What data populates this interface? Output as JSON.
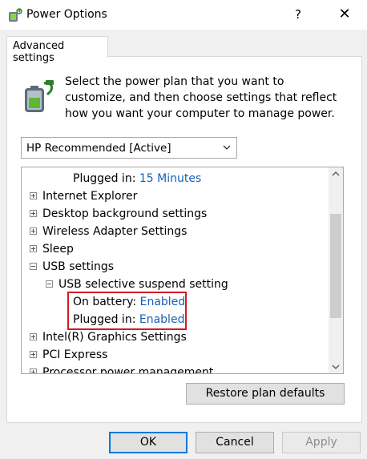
{
  "window": {
    "title": "Power Options",
    "help_label": "?",
    "close_label": "✕"
  },
  "tab": {
    "label": "Advanced settings"
  },
  "intro": {
    "text": "Select the power plan that you want to customize, and then choose settings that reflect how you want your computer to manage power."
  },
  "plan_select": {
    "value": "HP Recommended [Active]"
  },
  "tree": {
    "partial_top": {
      "label": "Plugged in:",
      "value": "15 Minutes"
    },
    "items": [
      {
        "label": "Internet Explorer"
      },
      {
        "label": "Desktop background settings"
      },
      {
        "label": "Wireless Adapter Settings"
      },
      {
        "label": "Sleep"
      },
      {
        "label": "USB settings"
      },
      {
        "label": "USB selective suspend setting"
      },
      {
        "label": "On battery:",
        "value": "Enabled"
      },
      {
        "label": "Plugged in:",
        "value": "Enabled"
      },
      {
        "label": "Intel(R) Graphics Settings"
      },
      {
        "label": "PCI Express"
      },
      {
        "label": "Processor power management"
      }
    ]
  },
  "buttons": {
    "restore": "Restore plan defaults",
    "ok": "OK",
    "cancel": "Cancel",
    "apply": "Apply"
  },
  "colors": {
    "link": "#1a5fb4",
    "highlight": "#d01c24",
    "focus": "#0078d7"
  }
}
